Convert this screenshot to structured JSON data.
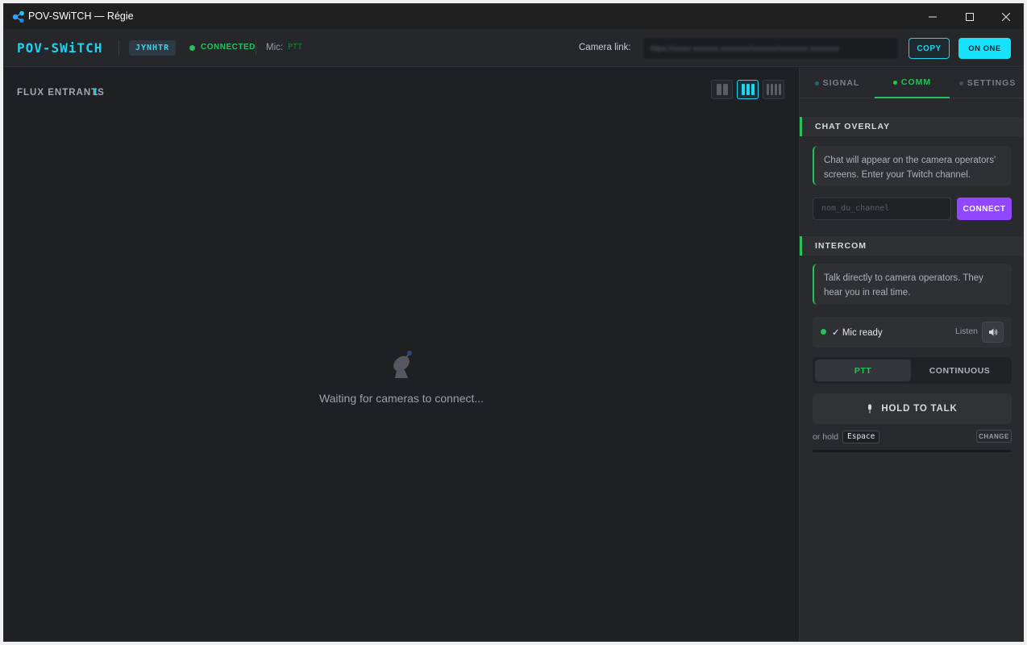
{
  "window": {
    "title": "POV-SWiTCH — Régie",
    "app_icon": "share-nodes-icon"
  },
  "header": {
    "logo": "POV-SWiTCH",
    "room_code": "JYNHTR",
    "status": "CONNECTED",
    "mic_label": "Mic:",
    "mic_value": "PTT",
    "camera_link_label": "Camera link:",
    "camera_link_value": "https://xxxxx-xxxxxxx.xxxxxxxx/xxxxxxx/xxxxxxxx-xxxxxxxx",
    "copy_label": "COPY",
    "on_one_label": "ON ONE"
  },
  "stage": {
    "flux_label": "FLUX ENTRANTS",
    "flux_count": "1",
    "layout_options": [
      "2 columns",
      "3 columns",
      "4 columns"
    ],
    "active_layout": "3 columns",
    "empty_icon": "satellite-dish-icon",
    "empty_message": "Waiting for cameras to connect..."
  },
  "panel": {
    "tabs": [
      {
        "label": "SIGNAL",
        "active": false
      },
      {
        "label": "COMM",
        "active": true
      },
      {
        "label": "SETTINGS",
        "active": false
      }
    ],
    "chat_overlay": {
      "heading": "CHAT OVERLAY",
      "info": "Chat will appear on the camera operators' screens. Enter your Twitch channel.",
      "channel_placeholder": "nom_du_channel",
      "connect_label": "CONNECT"
    },
    "intercom": {
      "heading": "INTERCOM",
      "info": "Talk directly to camera operators. They hear you in real time.",
      "mic_status": "✓ Mic ready",
      "listen_label": "Listen",
      "listen_icon": "speaker-icon",
      "modes": [
        "PTT",
        "CONTINUOUS"
      ],
      "active_mode": "PTT",
      "talk_label": "HOLD TO TALK",
      "talk_icon": "microphone-icon",
      "hotkey_prefix": "or hold",
      "hotkey": "Espace",
      "change_label": "CHANGE"
    }
  },
  "colors": {
    "accent": "#1fd3ef",
    "success": "#27c25b",
    "twitch": "#9146ff",
    "background": "#1f2024",
    "panel": "#292a2e"
  }
}
